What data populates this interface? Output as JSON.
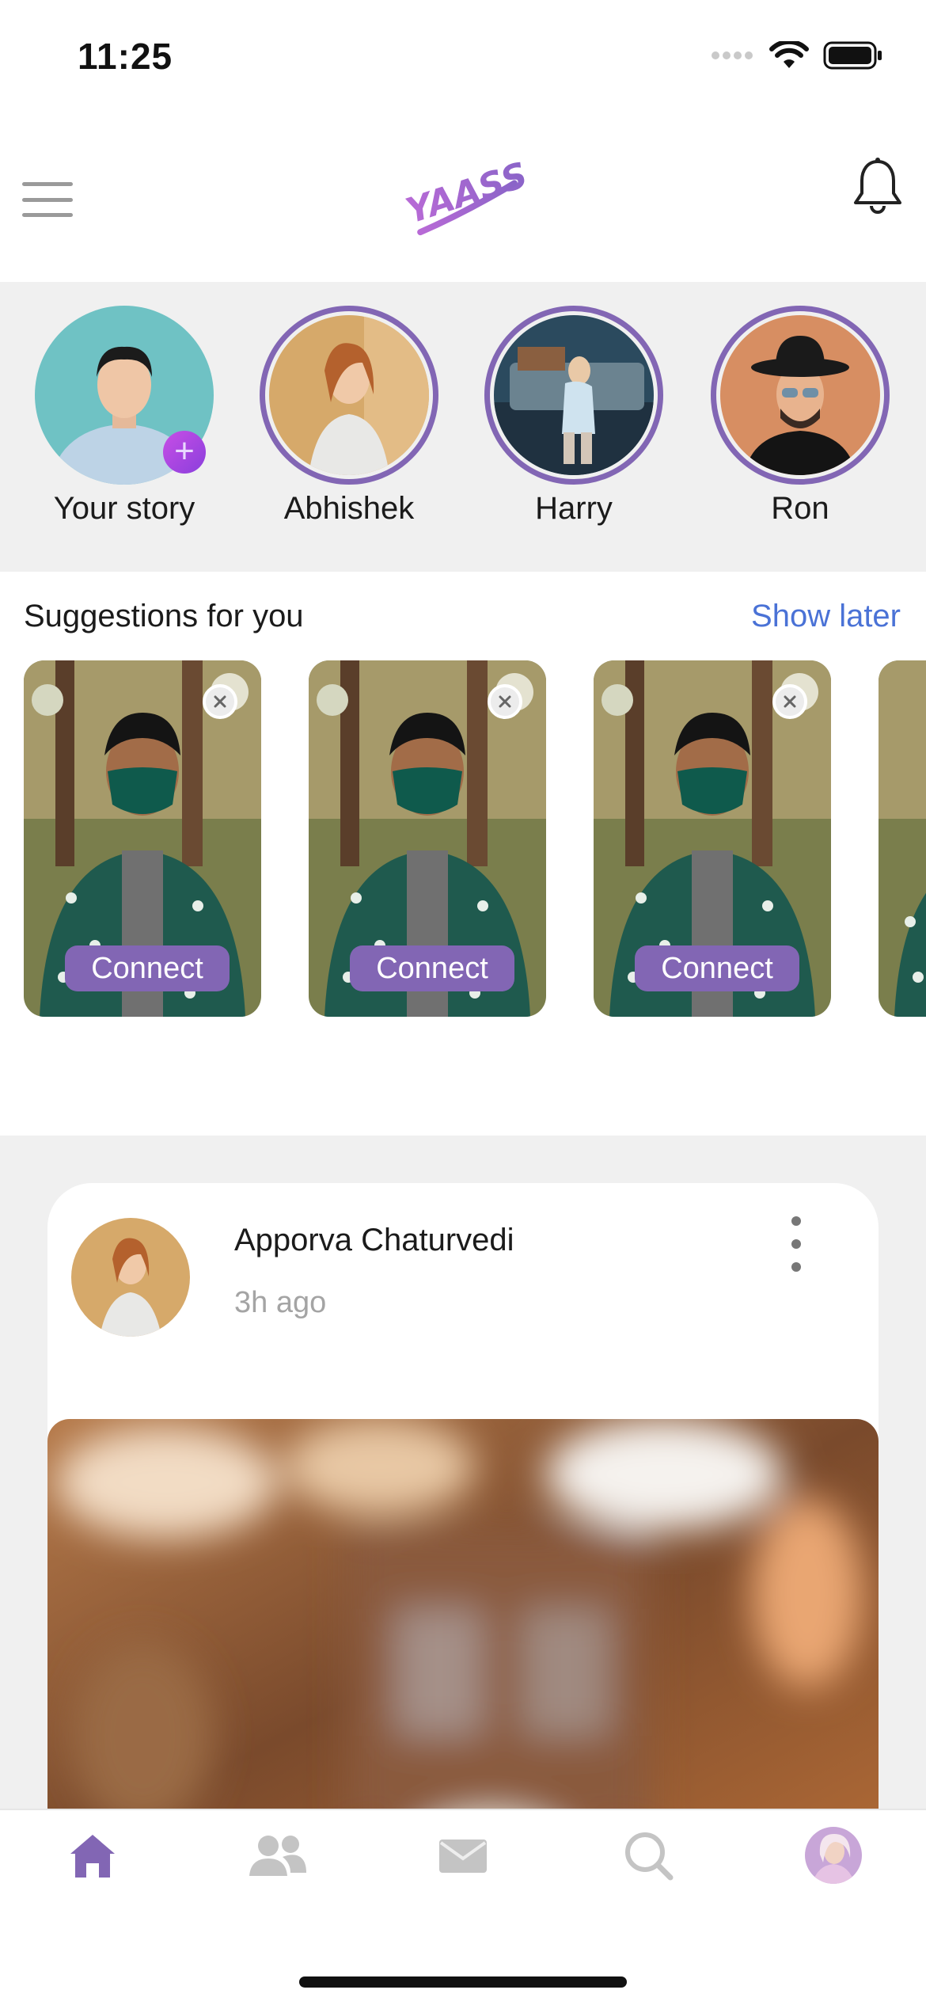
{
  "status_bar": {
    "time": "11:25"
  },
  "header": {
    "logo_text": "YAASS",
    "menu_icon": "hamburger-menu-icon",
    "notification_icon": "bell-icon"
  },
  "stories": [
    {
      "name": "Your story",
      "own": true
    },
    {
      "name": "Abhishek",
      "own": false
    },
    {
      "name": "Harry",
      "own": false
    },
    {
      "name": "Ron",
      "own": false
    }
  ],
  "suggestions": {
    "title": "Suggestions for you",
    "action": "Show later",
    "cards": [
      {
        "button": "Connect"
      },
      {
        "button": "Connect"
      },
      {
        "button": "Connect"
      }
    ]
  },
  "post": {
    "author": "Apporva Chaturvedi",
    "time": "3h ago"
  },
  "tab_bar": {
    "tabs": [
      "home-icon",
      "people-icon",
      "mail-icon",
      "search-icon",
      "profile-avatar"
    ],
    "active": "home-icon"
  },
  "colors": {
    "accent": "#8266b4",
    "link": "#4a72d6",
    "background_gray": "#f0f0f0"
  }
}
